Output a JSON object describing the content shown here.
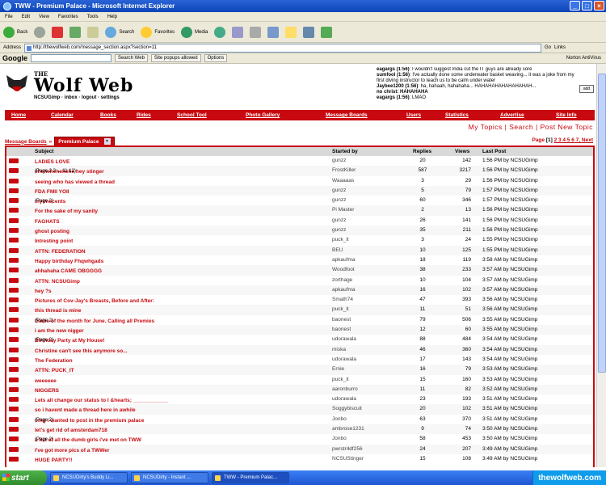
{
  "window": {
    "title": "TWW - Premium Palace - Microsoft Internet Explorer"
  },
  "menu": [
    "File",
    "Edit",
    "View",
    "Favorites",
    "Tools",
    "Help"
  ],
  "toolbar": {
    "back": "Back",
    "search": "Search",
    "favorites": "Favorites",
    "media": "Media"
  },
  "address": {
    "label": "Address",
    "url": "http://thewolfweb.com/message_section.aspx?section=11",
    "go": "Go",
    "links": "Links"
  },
  "google": {
    "logo": "Google",
    "search_web": "Search Web",
    "site_popups": "Site popups allowed",
    "options": "Options",
    "norton": "Norton AntiVirus"
  },
  "site": {
    "logo_the": "THE",
    "logo_title": "Wolf Web",
    "userline": "NCSUGimp · inbox · logout · settings",
    "chat": [
      {
        "nick": "eagargs (1:56)",
        "text": ": I wouldn't suggest India cut the IT guys are already sore"
      },
      {
        "nick": "sumfool (1:56)",
        "text": ": I've actually done some underwater basket weaving... it was a joke from my first diving instructor to teach us to be calm under water"
      },
      {
        "nick": "Jaybee1200 (1:56)",
        "text": ": ha, hahaah, hahahaha... HAHAHAHAHAHAHAHAH..."
      },
      {
        "nick": "no christ: HAHAHAHA",
        "text": ""
      },
      {
        "nick": "eagargs (1:56)",
        "text": ": LMAO"
      }
    ],
    "chat_add": "add",
    "nav": [
      "Home",
      "Calendar",
      "Books",
      "Rides",
      "School Tool",
      "Photo Gallery",
      "Message Boards",
      "Users",
      "Statistics",
      "Advertise",
      "Site Info"
    ],
    "sublinks": "My Topics | Search | Post New Topic",
    "crumb_root": "Message Boards",
    "crumb_sep": "»",
    "crumb_current": "Premium Palace",
    "pages_label": "Page",
    "pages_current": "[1]",
    "pages_rest": "2 3 4 5 6 7, Next"
  },
  "table": {
    "headers": {
      "subject": "Subject",
      "started_by": "Started by",
      "replies": "Replies",
      "views": "Views",
      "last_post": "Last Post"
    },
    "rows": [
      {
        "subject": "LADIES LOVE",
        "pages": "",
        "by": "gunzz",
        "replies": "20",
        "views": "142",
        "last": "1:56 PM by NCSUGimp"
      },
      {
        "subject": "ehehehehehehe hey stinger",
        "pages": "(Page 2 3 ... 11 12)",
        "by": "FrostKiller",
        "replies": "587",
        "views": "3217",
        "last": "1:56 PM by NCSUGimp"
      },
      {
        "subject": "seeing who has viewed a thread",
        "pages": "",
        "by": "Waaaaas",
        "replies": "3",
        "views": "29",
        "last": "1:56 PM by NCSUGimp"
      },
      {
        "subject": "FDA FMII YOII",
        "pages": "",
        "by": "gunzz",
        "replies": "5",
        "views": "79",
        "last": "1:57 PM by NCSUGimp"
      },
      {
        "subject": "mytmocents",
        "pages": "(Page 2)",
        "by": "gunzz",
        "replies": "60",
        "views": "346",
        "last": "1:57 PM by NCSUGimp"
      },
      {
        "subject": "For the sake of my sanity",
        "pages": "",
        "by": "Pi Master",
        "replies": "2",
        "views": "13",
        "last": "1:56 PM by NCSUGimp"
      },
      {
        "subject": "FAGHATS",
        "pages": "",
        "by": "gunzz",
        "replies": "26",
        "views": "141",
        "last": "1:56 PM by NCSUGimp"
      },
      {
        "subject": "ghost posting",
        "pages": "",
        "by": "gunzz",
        "replies": "35",
        "views": "211",
        "last": "1:56 PM by NCSUGimp"
      },
      {
        "subject": "Intresting point",
        "pages": "",
        "by": "puck_it",
        "replies": "3",
        "views": "24",
        "last": "1:55 PM by NCSUGimp"
      },
      {
        "subject": "ATTN: FEDERATION",
        "pages": "",
        "by": "BEU",
        "replies": "10",
        "views": "125",
        "last": "1:55 PM by NCSUGimp"
      },
      {
        "subject": "Happy birthday Fhqwhgads",
        "pages": "",
        "by": "apkaufma",
        "replies": "18",
        "views": "119",
        "last": "3:58 AM by NCSUGimp"
      },
      {
        "subject": "ahhahaha CAME OBGGGG",
        "pages": "",
        "by": "Woodfoot",
        "replies": "38",
        "views": "233",
        "last": "3:57 AM by NCSUGimp"
      },
      {
        "subject": "ATTN: NCSUGimp",
        "pages": "",
        "by": "zorthage",
        "replies": "10",
        "views": "104",
        "last": "3:57 AM by NCSUGimp"
      },
      {
        "subject": "hey ?s",
        "pages": "",
        "by": "apkaufma",
        "replies": "16",
        "views": "102",
        "last": "3:57 AM by NCSUGimp"
      },
      {
        "subject": "Pictures of Cov-Jay's Breasts, Before and After:",
        "pages": "",
        "by": "Smath74",
        "replies": "47",
        "views": "393",
        "last": "3:56 AM by NCSUGimp"
      },
      {
        "subject": "this thread is mine",
        "pages": "",
        "by": "puck_it",
        "replies": "11",
        "views": "51",
        "last": "3:56 AM by NCSUGimp"
      },
      {
        "subject": "Game of the month for June. Calling all Premies",
        "pages": "(Page 2)",
        "by": "baonest",
        "replies": "79",
        "views": "506",
        "last": "3:55 AM by NCSUGimp"
      },
      {
        "subject": "i am the new nigger",
        "pages": "",
        "by": "baonest",
        "replies": "12",
        "views": "60",
        "last": "3:55 AM by NCSUGimp"
      },
      {
        "subject": "Birthday Party at My House!",
        "pages": "(Page 2)",
        "by": "udorawala",
        "replies": "88",
        "views": "484",
        "last": "3:54 AM by NCSUGimp"
      },
      {
        "subject": "Christine can't see this anymore so...",
        "pages": "",
        "by": "miska",
        "replies": "46",
        "views": "360",
        "last": "3:54 AM by NCSUGimp"
      },
      {
        "subject": "The Federation",
        "pages": "",
        "by": "udorawala",
        "replies": "17",
        "views": "143",
        "last": "3:54 AM by NCSUGimp"
      },
      {
        "subject": "ATTN: PUCK_IT",
        "pages": "",
        "by": "Ernie",
        "replies": "16",
        "views": "79",
        "last": "3:53 AM by NCSUGimp"
      },
      {
        "subject": "weeeeee",
        "pages": "",
        "by": "puck_it",
        "replies": "15",
        "views": "160",
        "last": "3:53 AM by NCSUGimp"
      },
      {
        "subject": "NIGGERS",
        "pages": "",
        "by": "aaronburro",
        "replies": "11",
        "views": "82",
        "last": "3:52 AM by NCSUGimp"
      },
      {
        "subject": "Lets all change our status to I &hearts; ____________",
        "pages": "",
        "by": "udorawala",
        "replies": "23",
        "views": "193",
        "last": "3:51 AM by NCSUGimp"
      },
      {
        "subject": "so i havent made a thread here in awhile",
        "pages": "",
        "by": "Soggybiscuit",
        "replies": "20",
        "views": "102",
        "last": "3:51 AM by NCSUGimp"
      },
      {
        "subject": "omg i wanted to post in the premium palace",
        "pages": "(Page 2)",
        "by": "Jonbo",
        "replies": "63",
        "views": "370",
        "last": "3:51 AM by NCSUGimp"
      },
      {
        "subject": "let's get rid of amsterdam718",
        "pages": "",
        "by": "ambrose1231",
        "replies": "9",
        "views": "74",
        "last": "3:50 AM by NCSUGimp"
      },
      {
        "subject": "a list of all the dumb girls i've met on TWW",
        "pages": "(Page 2)",
        "by": "Jonbo",
        "replies": "58",
        "views": "453",
        "last": "3:50 AM by NCSUGimp"
      },
      {
        "subject": "I've got more pics of a TWWer",
        "pages": "",
        "by": "pwrstr4df256",
        "replies": "24",
        "views": "207",
        "last": "3:49 AM by NCSUGimp"
      },
      {
        "subject": "HUGE PARTY!!",
        "pages": "",
        "by": "NCSUStinger",
        "replies": "15",
        "views": "108",
        "last": "3:49 AM by NCSUGimp"
      }
    ]
  },
  "taskbar": {
    "start": "start",
    "tasks": [
      "NCSUDirty's Buddy Li...",
      "NCSUDirty - Instant ...",
      "TWW - Premium Palac..."
    ],
    "brand": "thewolfweb.com"
  }
}
